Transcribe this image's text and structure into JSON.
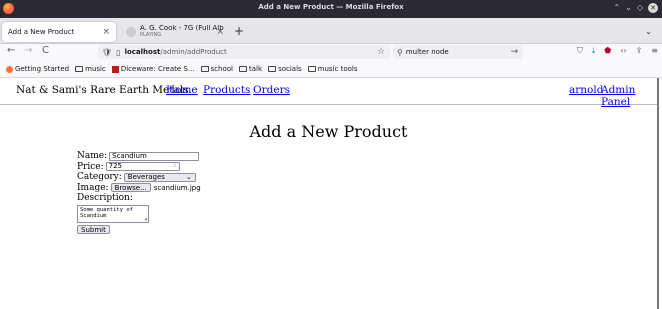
{
  "window": {
    "title": "Add a New Product — Mozilla Firefox",
    "controls": [
      "⌃",
      "⌄",
      "◇",
      "✕"
    ]
  },
  "tabs": [
    {
      "label": "Add a New Product",
      "close": "×",
      "active": true
    },
    {
      "label": "A. G. Cook - 7G (Full Alb",
      "sublabel": "PLAYING",
      "close": "×",
      "active": false
    }
  ],
  "tabstrip": {
    "new_tab": "+",
    "list_all": "⌄"
  },
  "navbar": {
    "back": "←",
    "forward": "→",
    "reload": "C",
    "url_host": "localhost",
    "url_path": "/admin/addProduct",
    "search_value": "multer node",
    "search_go": "→",
    "toolbar_icons": [
      "pocket-icon",
      "downloads-icon",
      "ublock-icon",
      "devtools-icon",
      "share-icon",
      "menu-icon"
    ]
  },
  "bookmarks": [
    {
      "label": "Getting Started",
      "icon": "firefox-icon"
    },
    {
      "label": "music",
      "icon": "folder-icon"
    },
    {
      "label": "Diceware: Create S...",
      "icon": "dice-icon"
    },
    {
      "label": "school",
      "icon": "folder-icon"
    },
    {
      "label": "talk",
      "icon": "folder-icon"
    },
    {
      "label": "socials",
      "icon": "folder-icon"
    },
    {
      "label": "music tools",
      "icon": "folder-icon"
    }
  ],
  "site_nav": {
    "brand": "Nat & Sami's Rare Earth Metals",
    "links": [
      "Home",
      "Products",
      "Orders"
    ],
    "user": "arnold",
    "admin": "Admin Panel"
  },
  "page": {
    "heading": "Add a New Product",
    "form": {
      "name_label": "Name:",
      "name_value": "Scandium",
      "price_label": "Price:",
      "price_value": "725",
      "category_label": "Category:",
      "category_value": "Beverages",
      "image_label": "Image:",
      "browse_label": "Browse...",
      "file_name": "scandium.jpg",
      "description_label": "Description:",
      "description_value": "Some quantity of\nScandium",
      "submit_label": "Submit"
    }
  }
}
